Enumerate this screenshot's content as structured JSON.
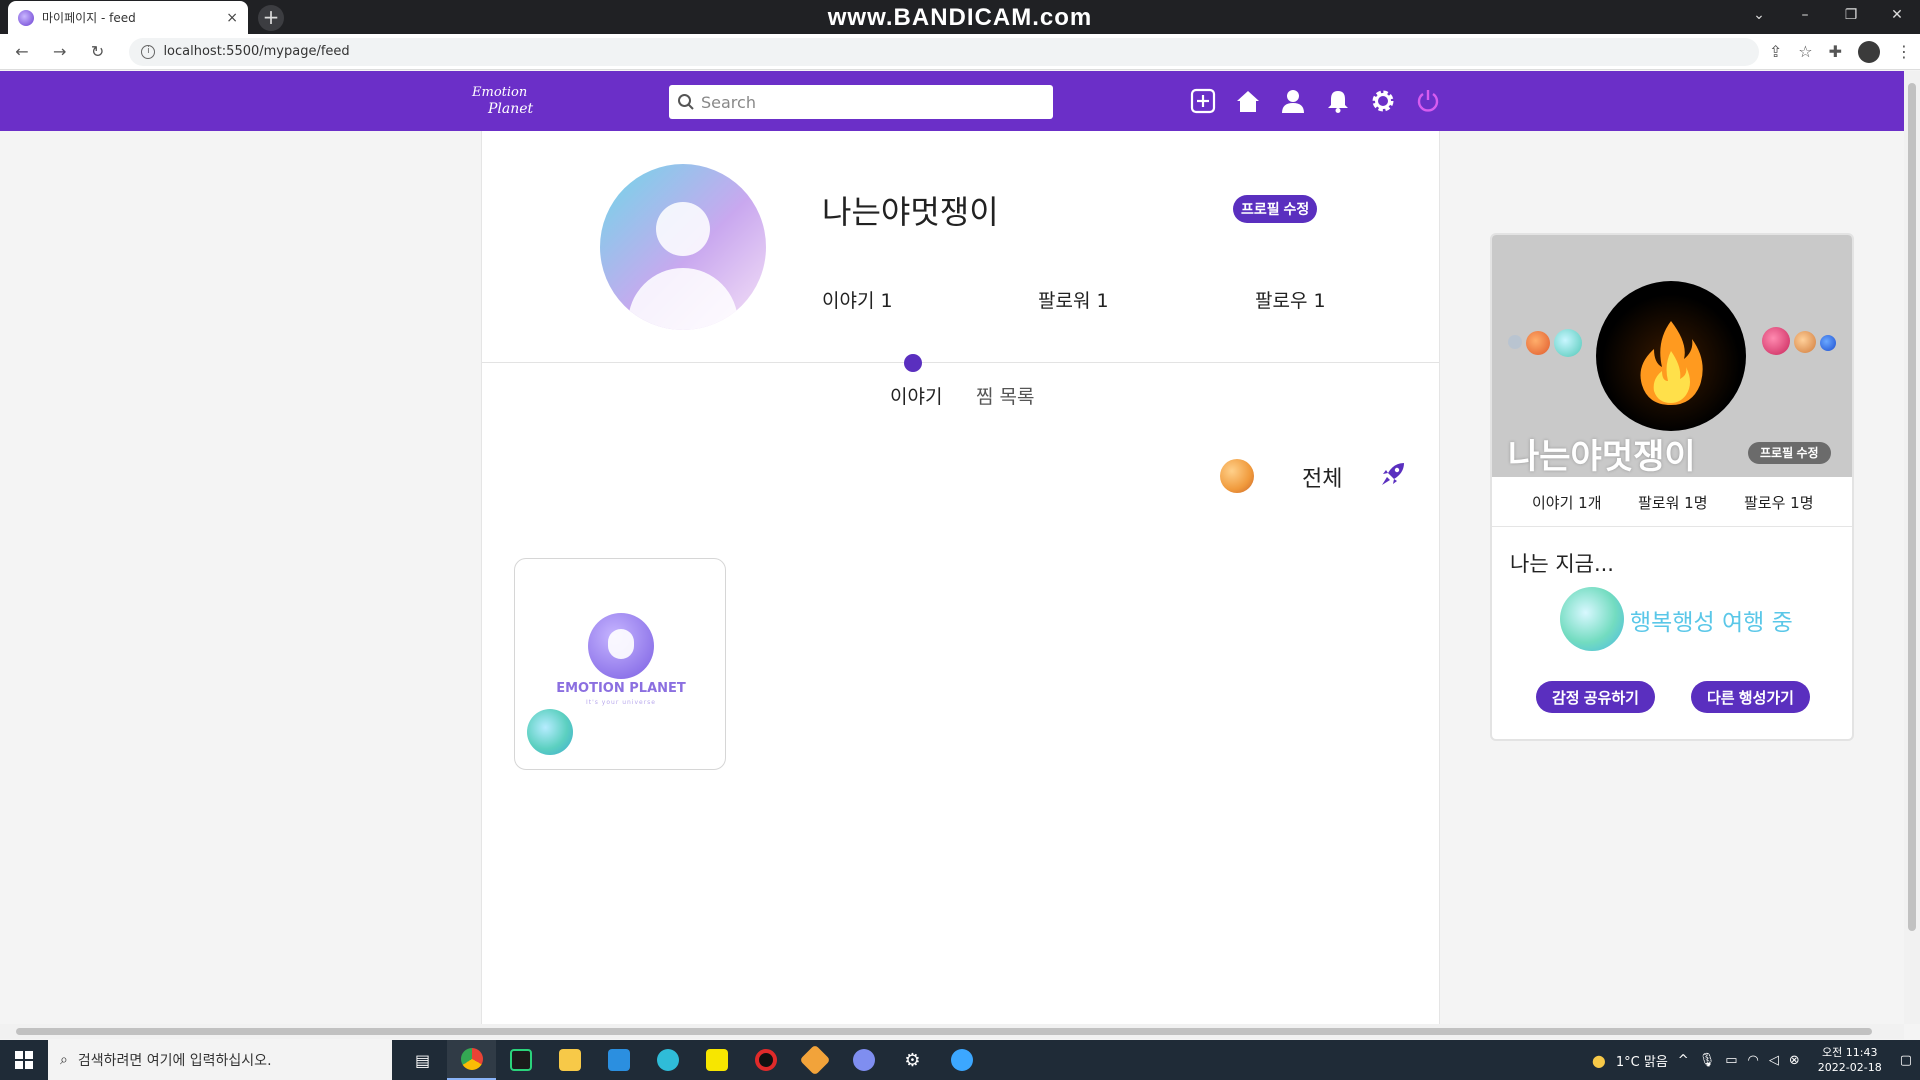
{
  "browser": {
    "tab_title": "마이페이지 - feed",
    "tab_close": "×",
    "new_tab": "+",
    "watermark": "www.BANDICAM.com",
    "url": "localhost:5500/mypage/feed"
  },
  "header": {
    "logo_line1": "Emotion",
    "logo_line2": "Planet",
    "search_placeholder": "Search",
    "icons": [
      "add-post-icon",
      "home-icon",
      "user-icon",
      "bell-icon",
      "gear-icon",
      "power-icon"
    ]
  },
  "profile": {
    "username": "나는야멋쟁이",
    "edit_label": "프로필 수정",
    "stories": "이야기 1",
    "followers": "팔로워 1",
    "following": "팔로우 1"
  },
  "tabs": {
    "stories": "이야기",
    "saved": "찜 목록"
  },
  "filter": {
    "all": "전체"
  },
  "post": {
    "brand": "EMOTION PLANET",
    "tagline": "It's your universe"
  },
  "side": {
    "username": "나는야멋쟁이",
    "edit_label": "프로필 수정",
    "stories": "이야기 1개",
    "followers": "팔로워 1명",
    "following": "팔로우 1명",
    "now_label": "나는 지금...",
    "status": "행복행성 여행 중",
    "share_button": "감정 공유하기",
    "other_planet_button": "다른 행성가기"
  },
  "taskbar": {
    "search_placeholder": "검색하려면 여기에 입력하십시오.",
    "weather": "1°C 맑음",
    "time": "오전 11:43",
    "date": "2022-02-18"
  },
  "colors": {
    "brand_purple": "#6b2fc8",
    "button_purple": "#5a2fbf",
    "status_cyan": "#5ac7e8"
  }
}
